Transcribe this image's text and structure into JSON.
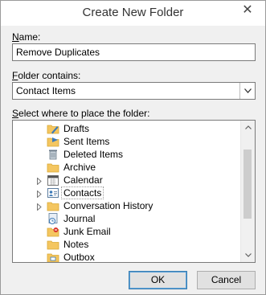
{
  "window": {
    "title": "Create New Folder",
    "close_glyph": "✕"
  },
  "name_field": {
    "label_key": "N",
    "label_rest": "ame:",
    "value": "Remove Duplicates"
  },
  "contains": {
    "label_key": "F",
    "label_rest": "older contains:",
    "selected": "Contact Items"
  },
  "location": {
    "label_key": "S",
    "label_rest": "elect where to place the folder:"
  },
  "tree": {
    "items": [
      {
        "label": "Drafts",
        "icon": "drafts-icon",
        "expandable": false
      },
      {
        "label": "Sent Items",
        "icon": "sent-items-icon",
        "expandable": false
      },
      {
        "label": "Deleted Items",
        "icon": "deleted-items-icon",
        "expandable": false
      },
      {
        "label": "Archive",
        "icon": "folder-icon",
        "expandable": false
      },
      {
        "label": "Calendar",
        "icon": "calendar-icon",
        "expandable": true
      },
      {
        "label": "Contacts",
        "icon": "contacts-icon",
        "expandable": true,
        "selected": true
      },
      {
        "label": "Conversation History",
        "icon": "folder-icon",
        "expandable": true
      },
      {
        "label": "Journal",
        "icon": "journal-icon",
        "expandable": false
      },
      {
        "label": "Junk Email",
        "icon": "junk-email-icon",
        "expandable": false
      },
      {
        "label": "Notes",
        "icon": "folder-icon",
        "expandable": false
      },
      {
        "label": "Outbox",
        "icon": "outbox-icon",
        "expandable": false
      }
    ]
  },
  "buttons": {
    "ok": "OK",
    "cancel": "Cancel"
  },
  "colors": {
    "selection_border": "#9a9a9a",
    "default_button": "#3c7fb1",
    "folder": "#f4c660"
  }
}
